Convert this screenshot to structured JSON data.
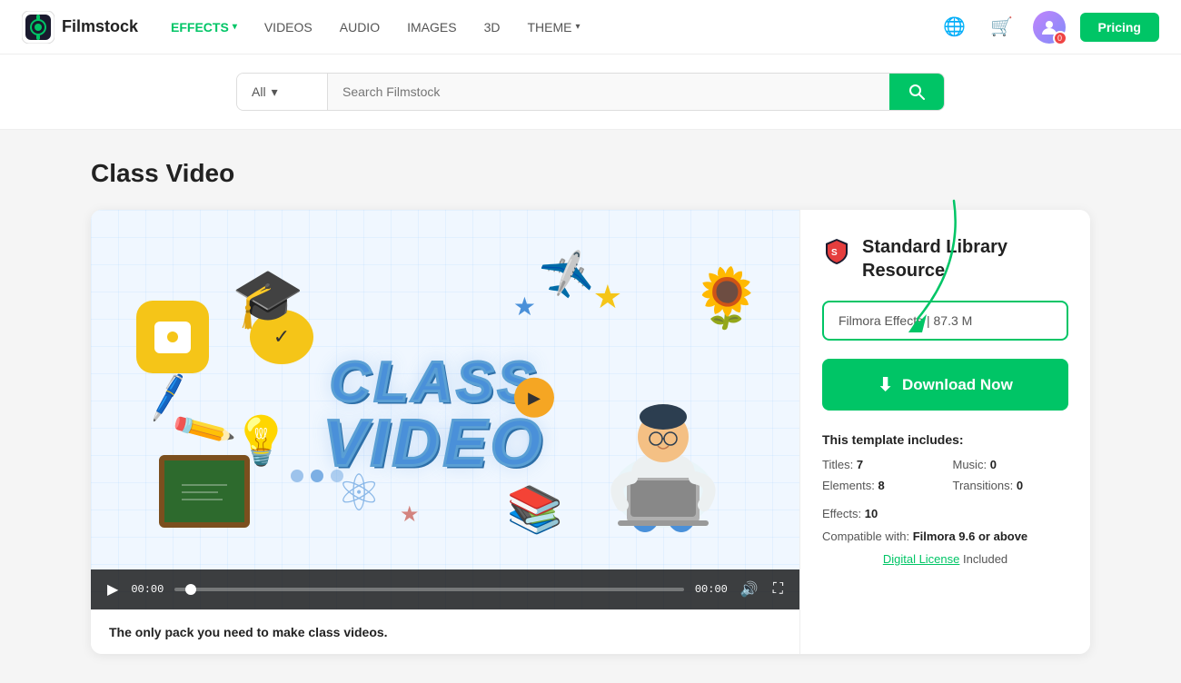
{
  "header": {
    "logo_text": "Filmstock",
    "nav_items": [
      {
        "label": "EFFECTS",
        "has_dropdown": true,
        "active": true
      },
      {
        "label": "VIDEOS",
        "has_dropdown": false,
        "active": false
      },
      {
        "label": "AUDIO",
        "has_dropdown": false,
        "active": false
      },
      {
        "label": "IMAGES",
        "has_dropdown": false,
        "active": false
      },
      {
        "label": "3D",
        "has_dropdown": false,
        "active": false
      },
      {
        "label": "THEME",
        "has_dropdown": true,
        "active": false
      }
    ],
    "pricing_label": "Pricing",
    "avatar_badge": "0"
  },
  "search": {
    "category_label": "All",
    "placeholder": "Search Filmstock"
  },
  "page": {
    "title": "Class Video",
    "description": "The only pack you need to make class videos."
  },
  "sidebar": {
    "resource_title": "Standard Library Resource",
    "file_info": "Filmora Effects | 87.3 M",
    "download_label": "Download Now",
    "template_includes_label": "This template includes:",
    "titles_label": "Titles:",
    "titles_value": "7",
    "music_label": "Music:",
    "music_value": "0",
    "elements_label": "Elements:",
    "elements_value": "8",
    "transitions_label": "Transitions:",
    "transitions_value": "0",
    "effects_label": "Effects:",
    "effects_value": "10",
    "compatible_label": "Compatible with:",
    "compatible_value": "Filmora 9.6 or above",
    "digital_license_label": "Digital License",
    "included_label": "Included"
  },
  "video": {
    "main_text_line1": "CLASS",
    "main_text_line2": "VIDEO",
    "time_start": "00:00",
    "time_end": "00:00"
  }
}
